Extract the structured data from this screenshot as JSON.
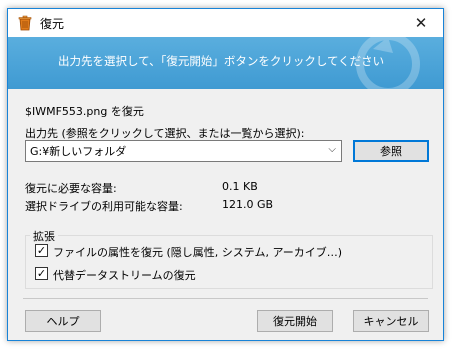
{
  "window": {
    "title": "復元",
    "close_symbol": "✕"
  },
  "banner": {
    "text": "出力先を選択して、「復元開始」ボタンをクリックしてください"
  },
  "file_line": "$IWMF553.png を復元",
  "output": {
    "label": "出力先 (参照をクリックして選択、または一覧から選択):",
    "selected": "G:¥新しいフォルダ",
    "browse_label": "参照"
  },
  "stats": {
    "required_label": "復元に必要な容量:",
    "required_value": "0.1 KB",
    "available_label": "選択ドライブの利用可能な容量:",
    "available_value": "121.0 GB"
  },
  "extended": {
    "label": "拡張",
    "options": [
      {
        "label": "ファイルの属性を復元 (隠し属性, システム, アーカイブ…)",
        "checked": true
      },
      {
        "label": "代替データストリームの復元",
        "checked": true
      }
    ]
  },
  "buttons": {
    "help": "ヘルプ",
    "start": "復元開始",
    "cancel": "キャンセル"
  },
  "icons": {
    "app": "recycle-bin-icon",
    "dropdown": "chevron-down-icon",
    "check": "checkmark-icon"
  },
  "colors": {
    "banner": "#4aa3d9",
    "accent": "#0078d7"
  }
}
